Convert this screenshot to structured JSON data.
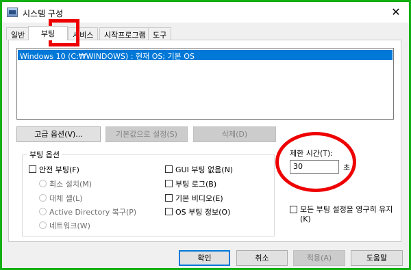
{
  "window": {
    "title": "시스템 구성",
    "close_glyph": "✕"
  },
  "tabs": [
    {
      "label": "일반"
    },
    {
      "label": "부팅"
    },
    {
      "label": "서비스"
    },
    {
      "label": "시작프로그램"
    },
    {
      "label": "도구"
    }
  ],
  "boot": {
    "os_entries": [
      "Windows 10 (C:₩WINDOWS) : 현재 OS; 기본 OS"
    ],
    "buttons": {
      "advanced": "고급 옵션(V)...",
      "set_default": "기본값으로 설정(S)",
      "delete": "삭제(D)"
    },
    "options_group": {
      "title": "부팅 옵션",
      "safe_boot": "안전 부팅(F)",
      "minimal": "최소 설치(M)",
      "alternate_shell": "대체 셸(L)",
      "ad_repair": "Active Directory 복구(P)",
      "network": "네트워크(W)",
      "no_gui": "GUI 부팅 없음(N)",
      "boot_log": "부팅 로그(B)",
      "base_video": "기본 비디오(E)",
      "os_boot_info": "OS 부팅 정보(O)"
    },
    "timeout": {
      "label": "제한 시간(T):",
      "value": "30",
      "unit": "초"
    },
    "permanent": {
      "line1": "모든 부팅 설정을 영구히 유지",
      "line2": "(K)"
    }
  },
  "footer": {
    "ok": "확인",
    "cancel": "취소",
    "apply": "적용(A)",
    "help": "도움말"
  },
  "colors": {
    "selection": "#0078d7",
    "annotation": "#ee0000",
    "frame": "#12b012"
  }
}
